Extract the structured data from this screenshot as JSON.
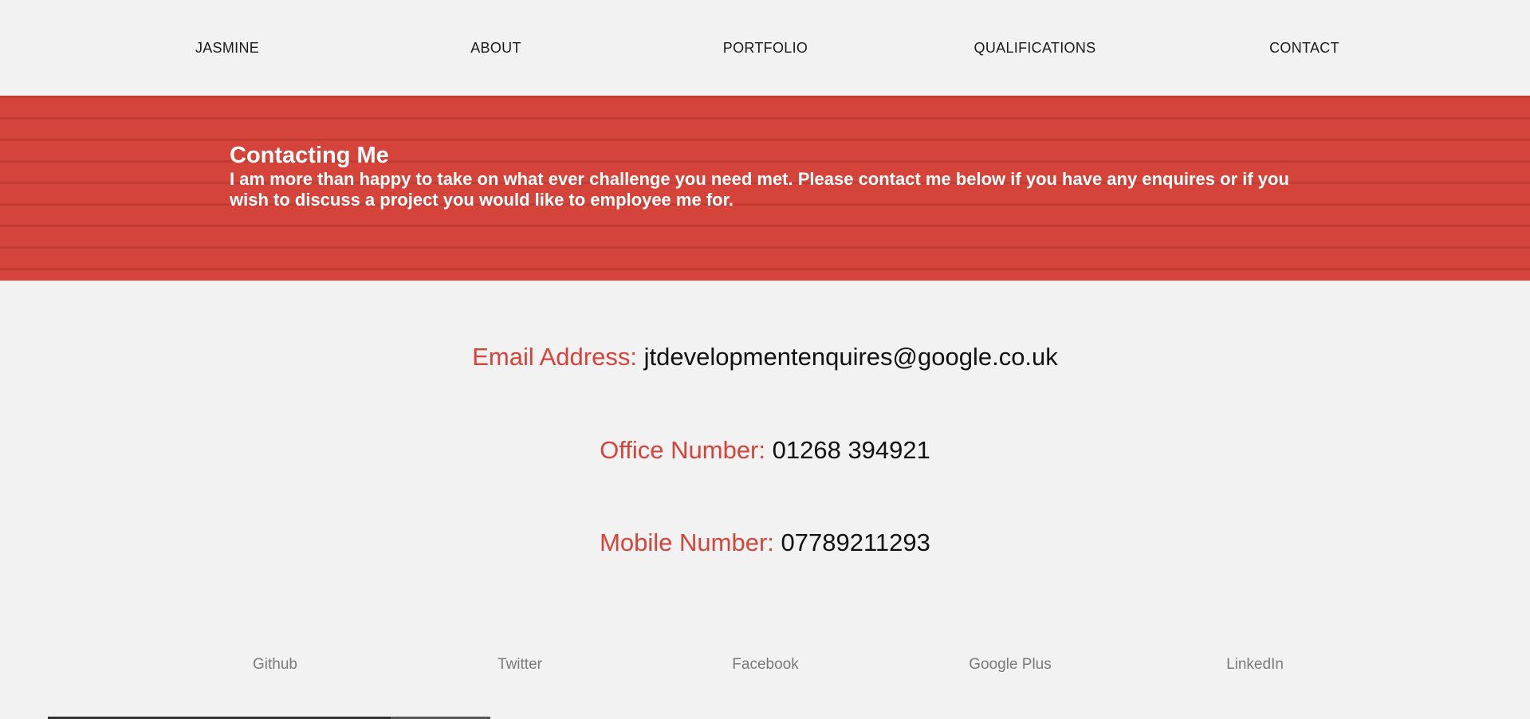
{
  "nav": {
    "items": [
      {
        "label": "JASMINE"
      },
      {
        "label": "ABOUT"
      },
      {
        "label": "PORTFOLIO"
      },
      {
        "label": "QUALIFICATIONS"
      },
      {
        "label": "CONTACT"
      }
    ]
  },
  "hero": {
    "title": "Contacting Me",
    "text": "I am more than happy to take on what ever challenge you need met. Please contact me below if you have any enquires or if you wish to discuss a project you would like to employee me for.",
    "background_color": "#d5443a"
  },
  "contact": {
    "email": {
      "label": "Email Address:",
      "value": "jtdevelopmentenquires@google.co.uk"
    },
    "office": {
      "label": "Office Number:",
      "value": "01268 394921"
    },
    "mobile": {
      "label": "Mobile Number:",
      "value": "07789211293"
    }
  },
  "social": {
    "items": [
      {
        "label": "Github"
      },
      {
        "label": "Twitter"
      },
      {
        "label": "Facebook"
      },
      {
        "label": "Google Plus"
      },
      {
        "label": "LinkedIn"
      }
    ]
  },
  "colors": {
    "accent": "#d5443a",
    "background": "#f2f2f2",
    "text": "#111111",
    "muted": "#7a7a7a"
  }
}
